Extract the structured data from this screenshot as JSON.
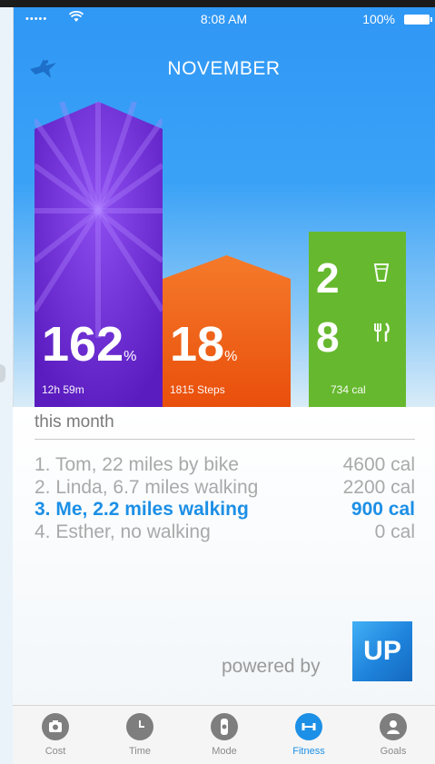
{
  "status_bar": {
    "signal": "•••••",
    "wifi_icon": "wifi-icon",
    "time": "8:08 AM",
    "battery": "100%"
  },
  "header": {
    "title": "NOVEMBER"
  },
  "stats": {
    "sleep": {
      "value": "162",
      "unit": "%",
      "detail": "12h 59m",
      "color": "#6a22c9"
    },
    "steps": {
      "value": "18",
      "unit": "%",
      "detail": "1815 Steps",
      "color": "#f06018"
    },
    "food": {
      "drinks": "2",
      "meals": "8",
      "detail": "734 cal",
      "color": "#66b92e"
    }
  },
  "leaderboard": {
    "heading": "this month",
    "rows": [
      {
        "name": "1. Tom, 22 miles by bike",
        "value": "4600 cal"
      },
      {
        "name": "2. Linda, 6.7 miles walking",
        "value": "2200 cal"
      },
      {
        "name": "3. Me, 2.2 miles walking",
        "value": "900 cal"
      },
      {
        "name": "4. Esther, no walking",
        "value": "0 cal"
      }
    ],
    "highlight_color": "#1c8fe6"
  },
  "footer": {
    "powered_by": "powered by",
    "brand": "UP"
  },
  "tabs": [
    {
      "label": "Cost",
      "icon": "camera-icon"
    },
    {
      "label": "Time",
      "icon": "clock-icon"
    },
    {
      "label": "Mode",
      "icon": "watch-icon"
    },
    {
      "label": "Fitness",
      "icon": "fitness-icon",
      "active": true
    },
    {
      "label": "Goals",
      "icon": "person-icon"
    }
  ]
}
